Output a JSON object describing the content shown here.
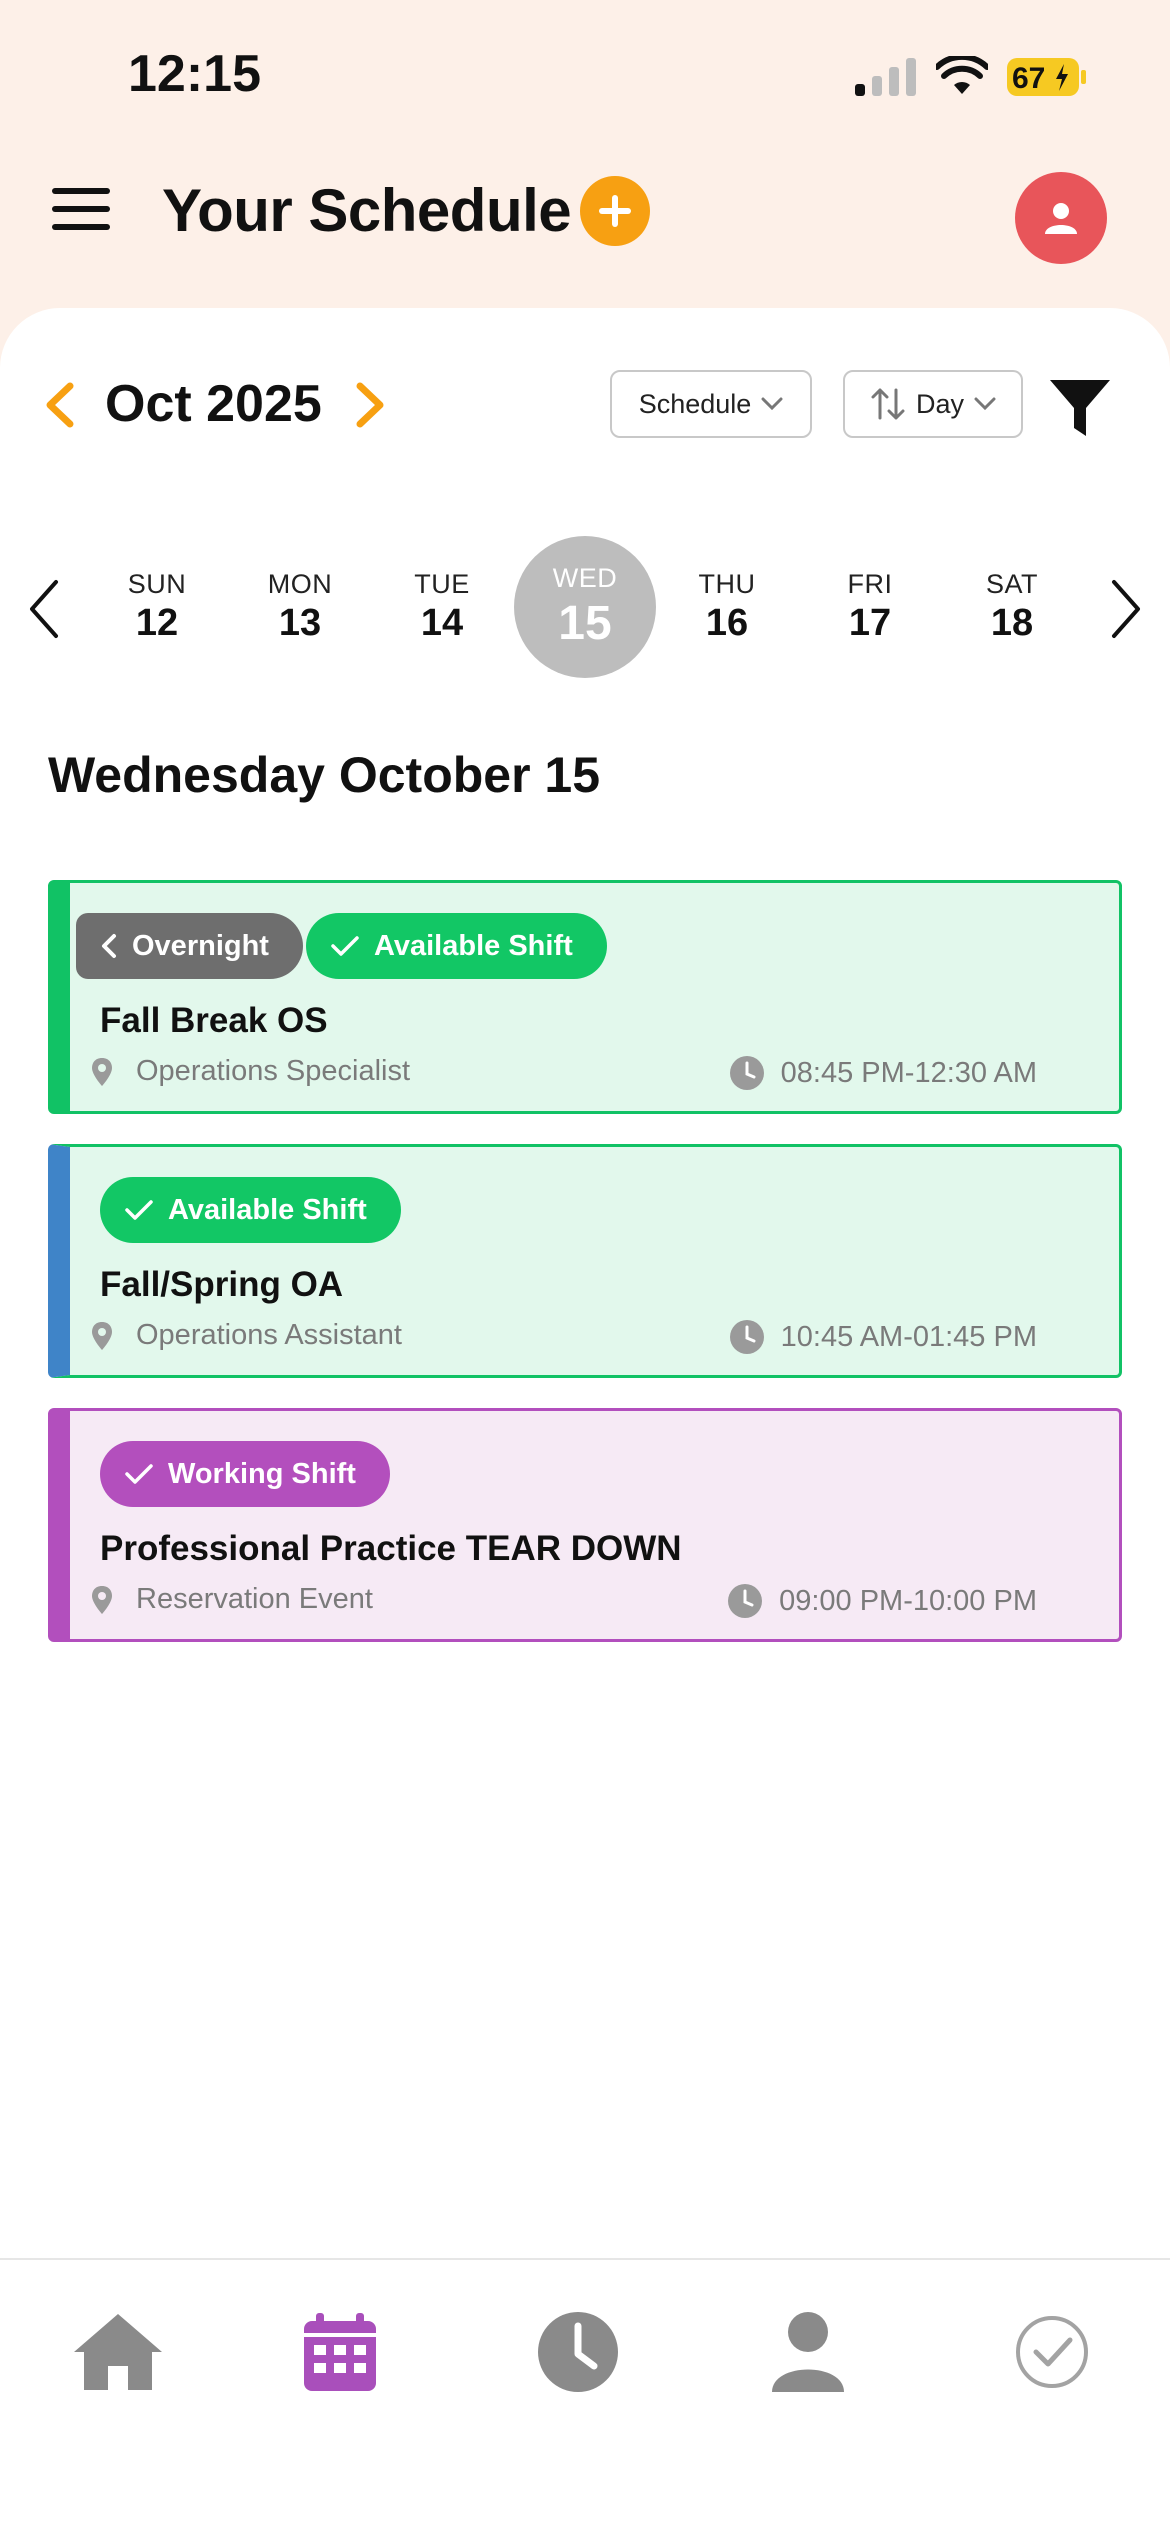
{
  "status_bar": {
    "time": "12:15",
    "battery": "67"
  },
  "header": {
    "title": "Your Schedule"
  },
  "toolbar": {
    "month": "Oct 2025",
    "view_dropdown": "Schedule",
    "range_dropdown": "Day"
  },
  "week": [
    {
      "dow": "SUN",
      "num": "12"
    },
    {
      "dow": "MON",
      "num": "13"
    },
    {
      "dow": "TUE",
      "num": "14"
    },
    {
      "dow": "WED",
      "num": "15",
      "selected": true
    },
    {
      "dow": "THU",
      "num": "16"
    },
    {
      "dow": "FRI",
      "num": "17"
    },
    {
      "dow": "SAT",
      "num": "18"
    }
  ],
  "date_heading": "Wednesday October 15",
  "shifts": [
    {
      "tags": [
        "Overnight",
        "Available Shift"
      ],
      "title": "Fall Break OS",
      "location": "Operations Specialist",
      "time": "08:45 PM-12:30 AM"
    },
    {
      "tags": [
        "Available Shift"
      ],
      "title": "Fall/Spring OA",
      "location": "Operations Assistant",
      "time": "10:45 AM-01:45 PM"
    },
    {
      "tags": [
        "Working Shift"
      ],
      "title": "Professional Practice TEAR DOWN",
      "location": "Reservation Event",
      "time": "09:00 PM-10:00 PM"
    }
  ],
  "colors": {
    "accent_orange": "#f7a012",
    "avatar_red": "#e8555a",
    "available_green": "#12c765",
    "working_purple": "#b34fbd",
    "nav_active": "#a94fbb",
    "nav_inactive": "#8a8a8a"
  },
  "bottom_nav": [
    {
      "icon": "home-icon"
    },
    {
      "icon": "calendar-icon",
      "active": true
    },
    {
      "icon": "clock-icon"
    },
    {
      "icon": "person-icon"
    },
    {
      "icon": "check-circle-icon"
    }
  ]
}
